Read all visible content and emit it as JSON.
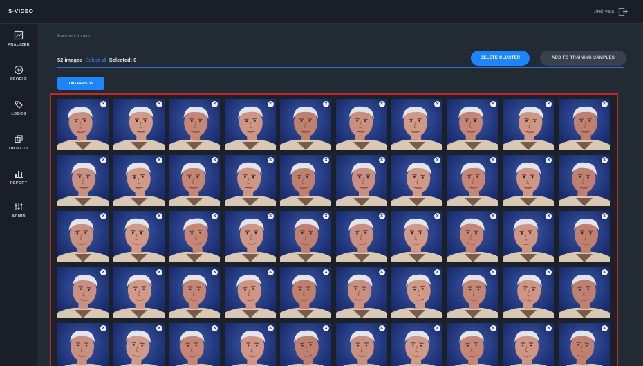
{
  "app": {
    "brand": "S-VIDEO",
    "user_name": "Aleš Vala"
  },
  "sidebar": {
    "items": [
      {
        "label": "ANALYZER",
        "icon": "analyzer-icon"
      },
      {
        "label": "PEOPLE",
        "icon": "people-icon"
      },
      {
        "label": "LOGOS",
        "icon": "tag-icon"
      },
      {
        "label": "OBJECTS",
        "icon": "objects-icon"
      },
      {
        "label": "REPORT",
        "icon": "bar-chart-icon"
      },
      {
        "label": "ADMIN",
        "icon": "sliders-icon"
      }
    ]
  },
  "header": {
    "back_link": "Back to Clusters",
    "image_count": "52 images",
    "select_all": "Select all",
    "selected": "Selected: 0"
  },
  "buttons": {
    "delete_cluster": "DELETE CLUSTER",
    "add_training": "ADD TO TRAINING SAMPLES",
    "tag_person": "TAG PERSON"
  },
  "grid": {
    "close_glyph": "×",
    "columns": 10,
    "visible_rows": 5,
    "accent_border": "#c3282d"
  },
  "colors": {
    "accent": "#1d86ff",
    "background": "#222a34",
    "sidebar": "#1a1f27"
  }
}
